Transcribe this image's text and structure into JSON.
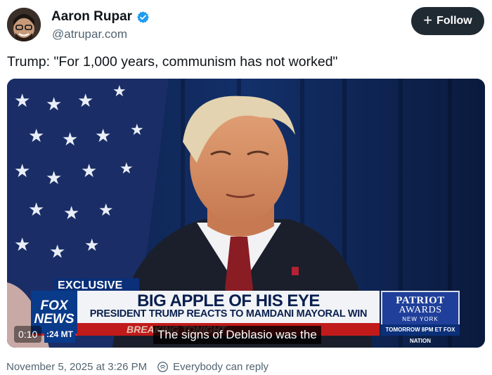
{
  "author": {
    "display_name": "Aaron Rupar",
    "handle": "@atrupar.com",
    "avatar_icon": "avatar-image"
  },
  "follow_button": {
    "label": "Follow",
    "icon": "plus-icon"
  },
  "post": {
    "text": "Trump: \"For 1,000 years, communism has not worked\""
  },
  "video": {
    "chyron": {
      "tag": "EXCLUSIVE",
      "headline": "BIG APPLE OF HIS EYE",
      "subhead": "PRESIDENT TRUMP REACTS TO MAMDANI MAYORAL WIN",
      "breaking": "BREAKING TONIGHT",
      "network_line1": "FOX",
      "network_line2": "NEWS",
      "clock": ":24 MT",
      "promo_title1": "PATRIOT",
      "promo_title2": "AWARDS",
      "promo_city": "NEW YORK",
      "promo_bar": "TOMORROW 8PM ET FOX NATION"
    },
    "timestamp": "0:10",
    "caption": "The signs of Deblasio was the"
  },
  "footer": {
    "date": "November 5, 2025 at 3:26 PM",
    "reply_setting": "Everybody can reply",
    "reply_icon": "reply-scope-icon"
  },
  "colors": {
    "follow_bg": "#202a33",
    "verified": "#1d9bf0",
    "muted_text": "#536471",
    "fox_blue": "#0a3a8a",
    "fox_red": "#c11a1a"
  }
}
